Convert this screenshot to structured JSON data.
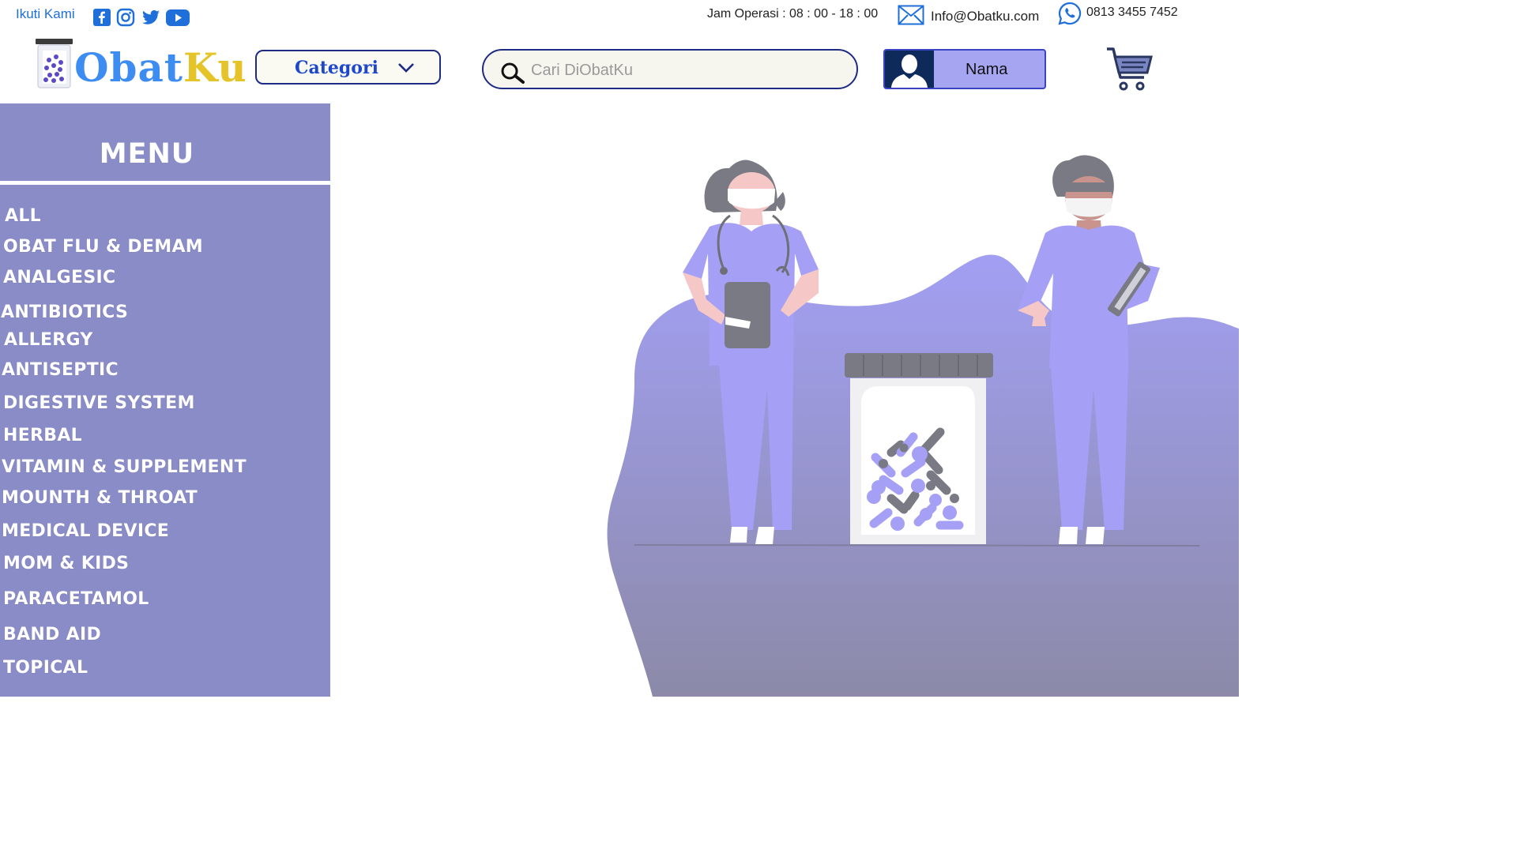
{
  "topbar": {
    "follow_label": "Ikuti Kami",
    "social_icons": [
      "facebook-icon",
      "instagram-icon",
      "twitter-icon",
      "youtube-icon"
    ],
    "hours": "Jam Operasi : 08 : 00 - 18 : 00",
    "email": "Info@Obatku.com",
    "phone": "0813 3455 7452"
  },
  "header": {
    "logo": {
      "part1": "Obat",
      "part2": "Ku"
    },
    "category_label": "Categori",
    "search_placeholder": "Cari DiObatKu",
    "user_name": "Nama"
  },
  "sidebar": {
    "title": "MENU",
    "items": [
      "ALL",
      "OBAT FLU & DEMAM",
      "ANALGESIC",
      "ANTIBIOTICS",
      "ALLERGY",
      "ANTISEPTIC",
      "DIGESTIVE SYSTEM",
      "HERBAL",
      "VITAMIN & SUPPLEMENT",
      "MOUNTH & THROAT",
      "MEDICAL DEVICE",
      "MOM & KIDS",
      "PARACETAMOL",
      "BAND AID",
      "TOPICAL"
    ]
  },
  "colors": {
    "sidebar": "#8a8cc7",
    "accent_blue": "#3d8cf2",
    "accent_yellow": "#e5c42a",
    "scrub": "#a5a0f5",
    "blob_top": "#a29ff3",
    "blob_bottom": "#8c8aa8"
  }
}
